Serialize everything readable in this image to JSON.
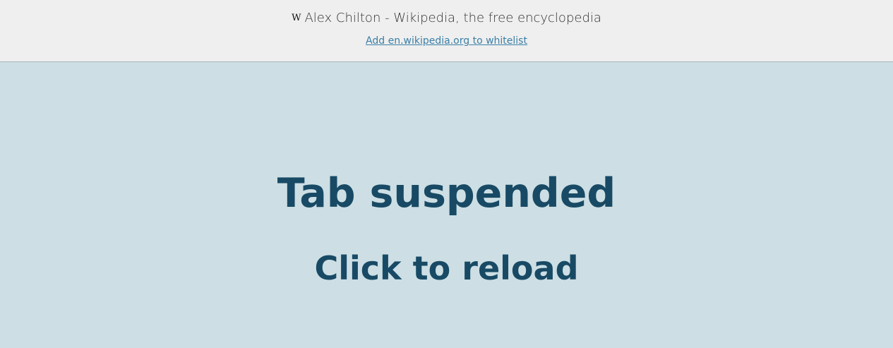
{
  "header": {
    "favicon_glyph": "W",
    "favicon_icon": "wikipedia-icon",
    "title": "Alex Chilton - Wikipedia, the free encyclopedia",
    "whitelist_link": "Add en.wikipedia.org to whitelist"
  },
  "main": {
    "heading": "Tab suspended",
    "reload_text": "Click to reload"
  },
  "colors": {
    "header_bg": "#efefef",
    "main_bg": "#cddfe4",
    "heading_text": "#184a65",
    "link": "#3a7fa6"
  }
}
